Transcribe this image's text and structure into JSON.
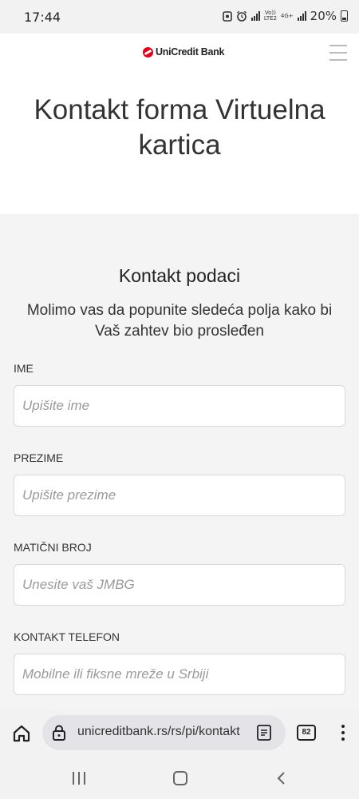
{
  "status_bar": {
    "time": "17:44",
    "network_top": "Vo)) LTE2",
    "network_4g": "4G+",
    "battery": "20%"
  },
  "header": {
    "logo_text": "UniCredit Bank",
    "brand_color": "#e2001a",
    "menu_icon": "hamburger-icon"
  },
  "hero": {
    "title": "Kontakt forma Virtuelna kartica"
  },
  "form": {
    "section_title": "Kontakt podaci",
    "description": "Molimo vas da popunite sledeća polja kako bi Vaš zahtev bio prosleđen",
    "fields": [
      {
        "label": "IME",
        "placeholder": "Upišite ime"
      },
      {
        "label": "PREZIME",
        "placeholder": "Upišite prezime"
      },
      {
        "label": "MATIČNI BROJ",
        "placeholder": "Unesite vaš JMBG"
      },
      {
        "label": "KONTAKT TELEFON",
        "placeholder": "Mobilne ili fiksne mreže u Srbiji"
      }
    ]
  },
  "browser": {
    "url": "unicreditbank.rs/rs/pi/kontakt",
    "tab_count": "82",
    "icons": [
      "home-icon",
      "lock-icon",
      "reader-icon",
      "tabs-icon",
      "menu-icon"
    ]
  },
  "navigation": {
    "icons": [
      "recent-apps-icon",
      "home-icon",
      "back-icon"
    ]
  }
}
